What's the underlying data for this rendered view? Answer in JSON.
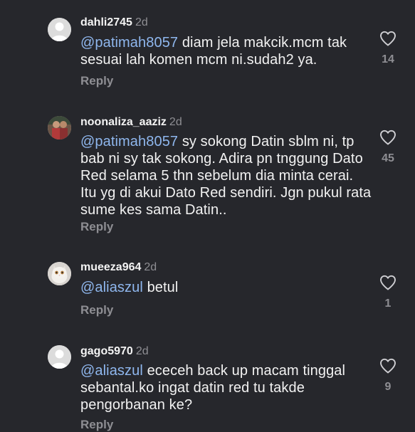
{
  "comments": [
    {
      "username": "dahli2745",
      "time": "2d",
      "mention": "@patimah8057",
      "text": " diam jela makcik.mcm tak sesuai lah komen mcm ni.sudah2 ya.",
      "reply_label": "Reply",
      "like_count": "14",
      "avatar": "default-avatar",
      "like_icon": "heart-outline-icon"
    },
    {
      "username": "noonaliza_aaziz",
      "time": "2d",
      "mention": "@patimah8057",
      "text": " sy sokong Datin sblm ni, tp bab ni sy tak sokong. Adira pn tnggung Dato Red selama 5 thn sebelum dia minta cerai. Itu yg di akui Dato Red sendiri. Jgn pukul rata sume kes sama Datin..",
      "reply_label": "Reply",
      "like_count": "45",
      "avatar": "photo-avatar",
      "like_icon": "heart-outline-icon"
    },
    {
      "username": "mueeza964",
      "time": "2d",
      "mention": "@aliaszul",
      "text": " betul",
      "reply_label": "Reply",
      "like_count": "1",
      "avatar": "cat-photo-avatar",
      "like_icon": "heart-outline-icon"
    },
    {
      "username": "gago5970",
      "time": "2d",
      "mention": "@aliaszul",
      "text": " ececeh back up macam tinggal sebantal.ko ingat datin red tu takde pengorbanan ke?",
      "reply_label": "Reply",
      "like_count": "9",
      "avatar": "default-avatar",
      "like_icon": "heart-outline-icon"
    }
  ],
  "colors": {
    "background": "#26272c",
    "mention": "#8fb7ee",
    "muted": "#8e8e93",
    "text": "#f2f2f2"
  }
}
